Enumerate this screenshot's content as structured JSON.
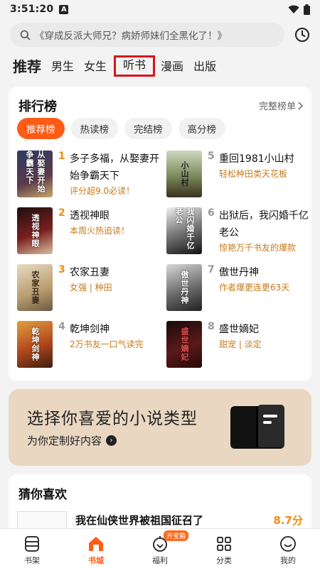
{
  "status_bar": {
    "time": "3:51:20",
    "notification_letter": "A"
  },
  "search": {
    "placeholder": "《穿成反派大师兄？病娇师妹们全黑化了！》"
  },
  "channel_tabs": [
    {
      "label": "推荐",
      "active": true
    },
    {
      "label": "男生"
    },
    {
      "label": "女生"
    },
    {
      "label": "听书",
      "highlighted": true
    },
    {
      "label": "漫画"
    },
    {
      "label": "出版"
    }
  ],
  "ranking": {
    "title": "排行榜",
    "full_list_label": "完整榜单",
    "filters": [
      {
        "label": "推荐榜",
        "active": true
      },
      {
        "label": "热读榜"
      },
      {
        "label": "完结榜"
      },
      {
        "label": "高分榜"
      }
    ],
    "books": [
      {
        "rank": "1",
        "title": "多子多福，从娶妻开始争霸天下",
        "tag": "评分超9.0必读！",
        "cover_text": "从娶妻开始争霸天下",
        "cover_color": "#3a3f58"
      },
      {
        "rank": "2",
        "title": "透视神眼",
        "tag": "本周火热追读！",
        "cover_text": "透视神眼",
        "cover_color": "#5a1818"
      },
      {
        "rank": "3",
        "title": "农家丑妻",
        "tag": "女强 | 种田",
        "cover_text": "农家丑妻",
        "cover_color": "#c9b48a"
      },
      {
        "rank": "4",
        "title": "乾坤剑神",
        "tag": "2万书友一口气读完",
        "cover_text": "乾坤剑神",
        "cover_color": "#b1461b"
      },
      {
        "rank": "5",
        "title": "重回1981小山村",
        "tag": "轻松种田类天花板",
        "cover_text": "小山村",
        "cover_color": "#4b5a3a"
      },
      {
        "rank": "6",
        "title": "出狱后，我闪婚千亿老公",
        "tag": "惊艳万千书友的爆款",
        "cover_text": "我闪婚千亿老公",
        "cover_color": "#2b2b2b"
      },
      {
        "rank": "7",
        "title": "傲世丹神",
        "tag": "作者爆更连更63天",
        "cover_text": "傲世丹神",
        "cover_color": "#6b6b6b"
      },
      {
        "rank": "8",
        "title": "盛世嫡妃",
        "tag": "甜宠 | 淡定",
        "cover_text": "盛世嫡妃",
        "cover_color": "#3d1515"
      }
    ]
  },
  "banner": {
    "title": "选择你喜爱的小说类型",
    "subtitle": "为你定制好内容",
    "arrow": "›"
  },
  "guess": {
    "title": "猜你喜欢",
    "book_title": "我在仙侠世界被祖国征召了",
    "score": "8.7分"
  },
  "bottom_nav": {
    "items": [
      {
        "label": "书架",
        "icon": "bookshelf-icon"
      },
      {
        "label": "书城",
        "icon": "home-icon",
        "active": true
      },
      {
        "label": "福利",
        "icon": "gift-icon",
        "badge": "开宝箱"
      },
      {
        "label": "分类",
        "icon": "grid-icon"
      },
      {
        "label": "我的",
        "icon": "profile-icon"
      }
    ]
  },
  "colors": {
    "accent": "#ff5b16",
    "tag": "#c77a17",
    "rank_top": "#f08c14",
    "highlight_box": "#d9141e",
    "banner_bg": "#ead7c2"
  }
}
